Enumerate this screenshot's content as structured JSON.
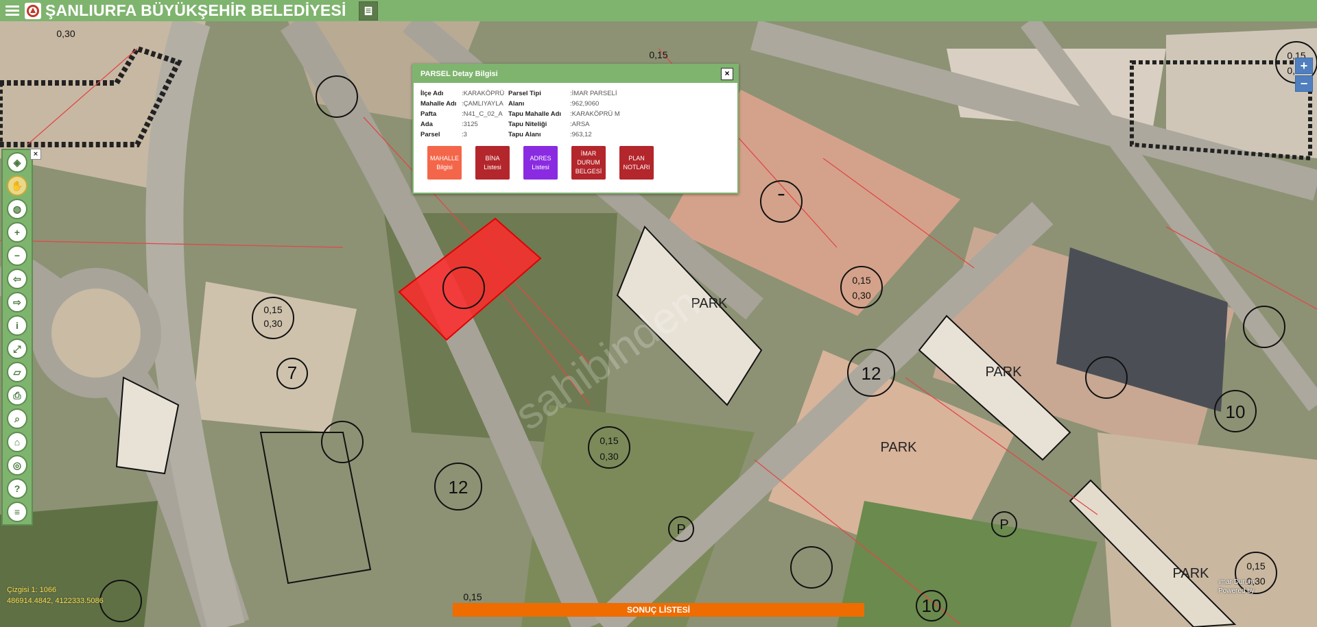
{
  "header": {
    "title": "ŞANLIURFA BÜYÜKŞEHİR BELEDİYESİ",
    "menu_icon": "hamburger-icon",
    "logo_icon": "municipality-logo-icon",
    "document_icon": "document-list-icon"
  },
  "zoom": {
    "in": "+",
    "out": "−"
  },
  "toolbar": {
    "close": "×",
    "buttons": [
      {
        "name": "layers-icon",
        "glyph": "◈"
      },
      {
        "name": "pan-hand-icon",
        "glyph": "✋"
      },
      {
        "name": "globe-icon",
        "glyph": "◍"
      },
      {
        "name": "zoom-in-icon",
        "glyph": "+"
      },
      {
        "name": "zoom-out-icon",
        "glyph": "−"
      },
      {
        "name": "previous-extent-icon",
        "glyph": "⇦"
      },
      {
        "name": "next-extent-icon",
        "glyph": "⇨"
      },
      {
        "name": "info-icon",
        "glyph": "i"
      },
      {
        "name": "measure-icon",
        "glyph": "⤢"
      },
      {
        "name": "ruler-icon",
        "glyph": "▱"
      },
      {
        "name": "print-icon",
        "glyph": "⎙"
      },
      {
        "name": "search-parcel-icon",
        "glyph": "⌕"
      },
      {
        "name": "address-icon",
        "glyph": "⌂"
      },
      {
        "name": "location-icon",
        "glyph": "◎"
      },
      {
        "name": "help-icon",
        "glyph": "?"
      },
      {
        "name": "list-icon",
        "glyph": "≡"
      }
    ]
  },
  "popup": {
    "title": "PARSEL Detay Bilgisi",
    "close": "×",
    "rows": [
      {
        "l1": "İlçe Adı",
        "v1": ":KARAKÖPRÜ",
        "l2": "Parsel Tipi",
        "v2": ":İMAR PARSELİ"
      },
      {
        "l1": "Mahalle Adı",
        "v1": ":ÇAMLIYAYLA",
        "l2": "Alanı",
        "v2": ":962,9060"
      },
      {
        "l1": "Pafta",
        "v1": ":N41_C_02_A",
        "l2": "Tapu Mahalle Adı",
        "v2": ":KARAKÖPRÜ M"
      },
      {
        "l1": "Ada",
        "v1": ":3125",
        "l2": "Tapu Niteliği",
        "v2": ":ARSA"
      },
      {
        "l1": "Parsel",
        "v1": ":3",
        "l2": "Tapu Alanı",
        "v2": ":963,12"
      }
    ],
    "actions": [
      {
        "label": "MAHALLE\nBilgisi",
        "color": "#f4664a",
        "name": "mahalle-bilgisi-button"
      },
      {
        "label": "BİNA\nListesi",
        "color": "#b3262b",
        "name": "bina-listesi-button"
      },
      {
        "label": "ADRES\nListesi",
        "color": "#8a2be2",
        "name": "adres-listesi-button"
      },
      {
        "label": "İMAR\nDURUM\nBELGESİ",
        "color": "#b3262b",
        "name": "imar-durum-belgesi-button"
      },
      {
        "label": "PLAN\nNOTLARI",
        "color": "#b3262b",
        "name": "plan-notlari-button"
      }
    ]
  },
  "map": {
    "labels": [
      "0,30",
      "0,15",
      "0,30",
      "0,15",
      "0,30",
      "0,15",
      "0,30",
      "0,15",
      "0,30",
      "0,15",
      "0,30",
      "0,15",
      "0,30",
      "0,15",
      "0,30",
      "PARK",
      "PARK",
      "PARK",
      "PARK",
      "P",
      "P",
      "12",
      "12",
      "10",
      "10",
      "7",
      "0",
      "ımar Durum",
      "Powered by"
    ],
    "watermark": "sahibinden"
  },
  "bottom": {
    "result_label": "SONUÇ LİSTESİ",
    "coords_line1": "Çizgisi 1: 1066",
    "coords_line2": "486914.4842, 4122333.5086"
  },
  "colors": {
    "header_green": "#7fb46f",
    "parcel_red": "#ff2a2a",
    "result_orange": "#ef6c00",
    "zoom_blue": "#4f7fbf"
  }
}
